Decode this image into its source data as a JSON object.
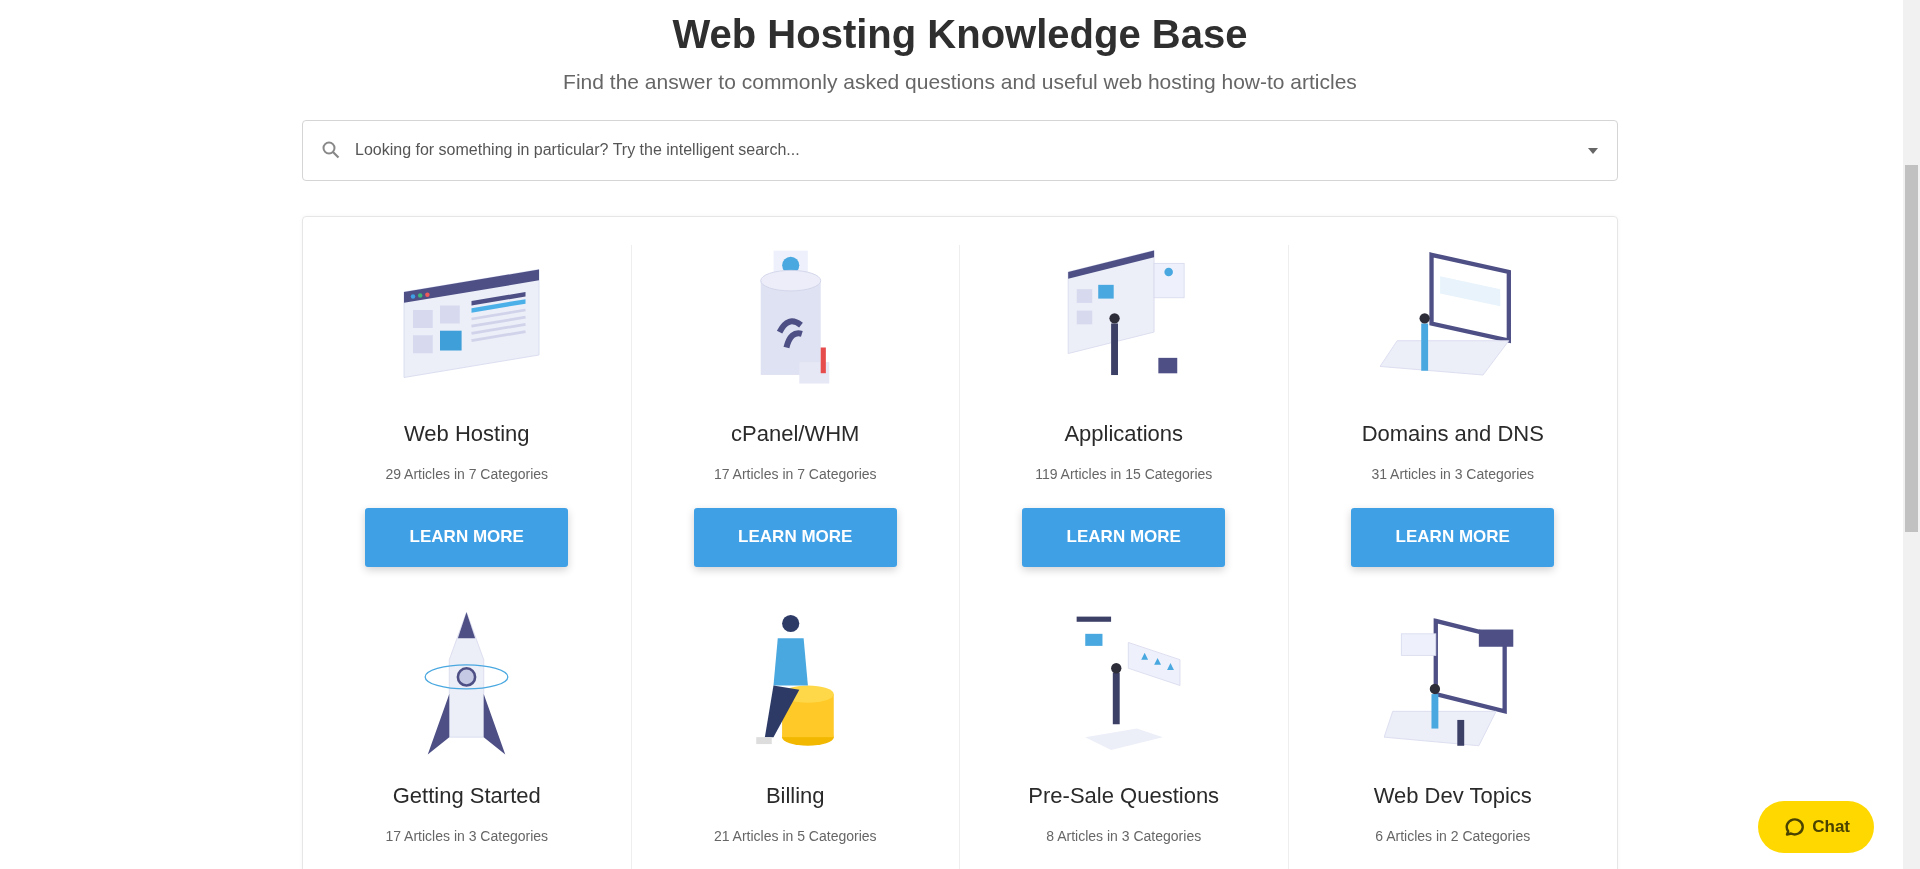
{
  "header": {
    "title": "Web Hosting Knowledge Base",
    "subtitle": "Find the answer to commonly asked questions and useful web hosting how-to articles"
  },
  "search": {
    "placeholder": "Looking for something in particular? Try the intelligent search..."
  },
  "topics": [
    {
      "title": "Web Hosting",
      "count": "29 Articles in 7 Categories",
      "button": "LEARN MORE"
    },
    {
      "title": "cPanel/WHM",
      "count": "17 Articles in 7 Categories",
      "button": "LEARN MORE"
    },
    {
      "title": "Applications",
      "count": "119 Articles in 15 Categories",
      "button": "LEARN MORE"
    },
    {
      "title": "Domains and DNS",
      "count": "31 Articles in 3 Categories",
      "button": "LEARN MORE"
    },
    {
      "title": "Getting Started",
      "count": "17 Articles in 3 Categories"
    },
    {
      "title": "Billing",
      "count": "21 Articles in 5 Categories"
    },
    {
      "title": "Pre-Sale Questions",
      "count": "8 Articles in 3 Categories"
    },
    {
      "title": "Web Dev Topics",
      "count": "6 Articles in 2 Categories"
    }
  ],
  "chat": {
    "label": "Chat"
  }
}
